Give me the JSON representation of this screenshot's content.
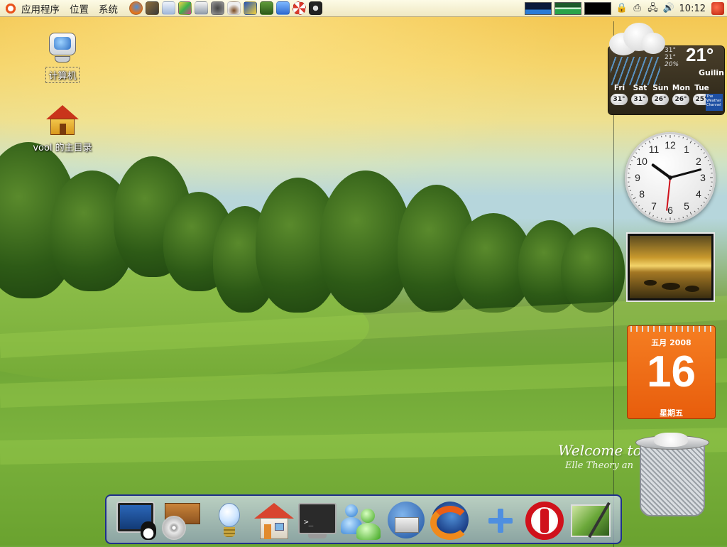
{
  "top_panel": {
    "menus": [
      "应用程序",
      "位置",
      "系统"
    ],
    "launchers": [
      "firefox-icon",
      "gimp-icon",
      "mail-icon",
      "paint-icon",
      "image-viewer-icon",
      "media-icon",
      "coffee-icon",
      "network-icon",
      "book-icon",
      "chat-icon",
      "lifesaver-icon",
      "camera-icon"
    ],
    "clock": "10:12"
  },
  "desktop_icons": [
    {
      "label": "计算机"
    },
    {
      "label": "vool 的主目录"
    }
  ],
  "weather": {
    "temp": "21°",
    "high": "31°",
    "low": "21°",
    "humidity": "20%",
    "city": "Guilin",
    "forecast": [
      {
        "day": "Fri",
        "temp": "31°"
      },
      {
        "day": "Sat",
        "temp": "31°"
      },
      {
        "day": "Sun",
        "temp": "26°"
      },
      {
        "day": "Mon",
        "temp": "26°"
      },
      {
        "day": "Tue",
        "temp": "25°"
      }
    ],
    "provider": "The Weather Channel"
  },
  "analog_clock": {
    "numbers": [
      "12",
      "1",
      "2",
      "3",
      "4",
      "5",
      "6",
      "7",
      "8",
      "9",
      "10",
      "11"
    ],
    "hour": 10,
    "minute": 12,
    "second": 31
  },
  "calendar": {
    "month_year": "五月 2008",
    "day": "16",
    "weekday": "星期五"
  },
  "wallpaper_text": {
    "title": "Welcome to",
    "subtitle": "Elle Theory an"
  },
  "dock": {
    "items": [
      "system-monitor",
      "package-manager",
      "idea-bulb",
      "home-folder",
      "terminal",
      "messenger",
      "thunderbird",
      "firefox",
      "add-launcher",
      "quit",
      "wallpaper-settings"
    ]
  }
}
